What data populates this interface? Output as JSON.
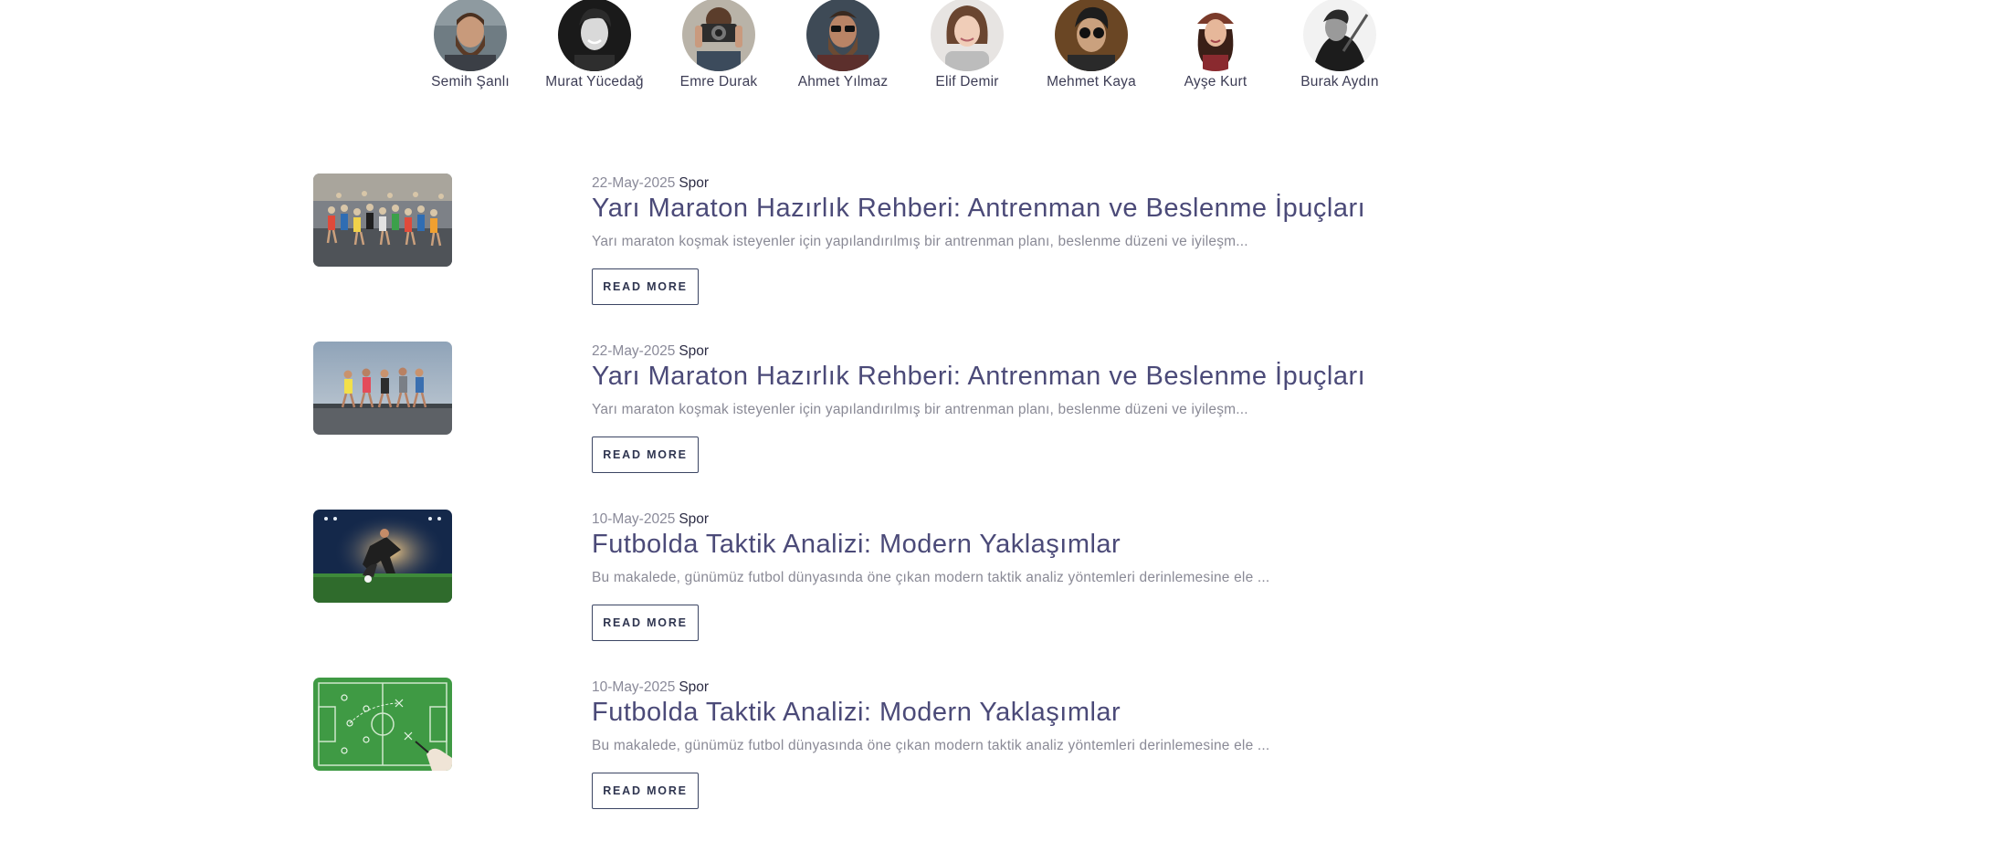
{
  "authors": [
    {
      "name": "Semih Şanlı"
    },
    {
      "name": "Murat Yücedağ"
    },
    {
      "name": "Emre Durak"
    },
    {
      "name": "Ahmet Yılmaz"
    },
    {
      "name": "Elif Demir"
    },
    {
      "name": "Mehmet Kaya"
    },
    {
      "name": "Ayşe Kurt"
    },
    {
      "name": "Burak Aydın"
    }
  ],
  "posts": [
    {
      "date": "22-May-2025",
      "category": "Spor",
      "title": "Yarı Maraton Hazırlık Rehberi: Antrenman ve Beslenme İpuçları",
      "excerpt": "Yarı maraton koşmak isteyenler için yapılandırılmış bir antrenman planı, beslenme düzeni ve iyileşm...",
      "read_more": "READ MORE"
    },
    {
      "date": "22-May-2025",
      "category": "Spor",
      "title": "Yarı Maraton Hazırlık Rehberi: Antrenman ve Beslenme İpuçları",
      "excerpt": "Yarı maraton koşmak isteyenler için yapılandırılmış bir antrenman planı, beslenme düzeni ve iyileşm...",
      "read_more": "READ MORE"
    },
    {
      "date": "10-May-2025",
      "category": "Spor",
      "title": "Futbolda Taktik Analizi: Modern Yaklaşımlar",
      "excerpt": "Bu makalede, günümüz futbol dünyasında öne çıkan modern taktik analiz yöntemleri derinlemesine ele ...",
      "read_more": "READ MORE"
    },
    {
      "date": "10-May-2025",
      "category": "Spor",
      "title": "Futbolda Taktik Analizi: Modern Yaklaşımlar",
      "excerpt": "Bu makalede, günümüz futbol dünyasında öne çıkan modern taktik analiz yöntemleri derinlemesine ele ...",
      "read_more": "READ MORE"
    }
  ]
}
